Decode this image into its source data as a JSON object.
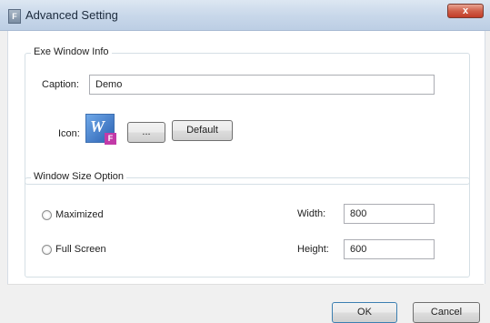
{
  "window": {
    "title": "Advanced Setting",
    "app_icon": "F",
    "close_glyph": "x"
  },
  "exe_window_info": {
    "group_label": "Exe Window Info",
    "caption_label": "Caption:",
    "caption_value": "Demo",
    "icon_label": "Icon:",
    "browse_label": "...",
    "default_label": "Default",
    "icon_letter": "W",
    "icon_badge": "F"
  },
  "window_size_option": {
    "group_label": "Window Size Option",
    "maximized_label": "Maximized",
    "fullscreen_label": "Full Screen",
    "width_label": "Width:",
    "width_value": "800",
    "height_label": "Height:",
    "height_value": "600"
  },
  "footer": {
    "ok_label": "OK",
    "cancel_label": "Cancel"
  },
  "colors": {
    "titlebar": "#c9d8ea",
    "close": "#c23c28",
    "panel": "#ffffff",
    "footer": "#f0f0f0"
  }
}
